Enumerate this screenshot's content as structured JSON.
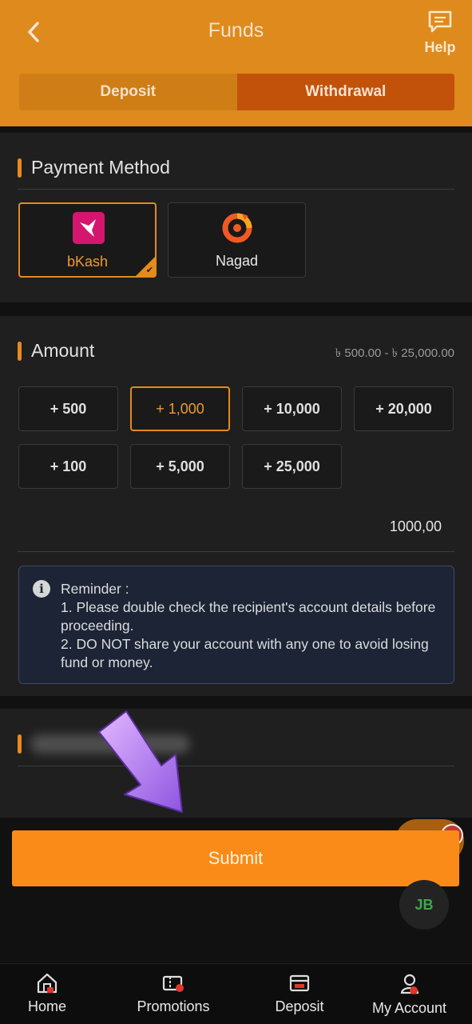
{
  "header": {
    "title": "Funds",
    "help_label": "Help",
    "tabs": [
      {
        "label": "Deposit",
        "active": false
      },
      {
        "label": "Withdrawal",
        "active": true
      }
    ]
  },
  "payment_method": {
    "title": "Payment Method",
    "options": [
      {
        "name": "bKash",
        "selected": true,
        "icon": "bkash-logo"
      },
      {
        "name": "Nagad",
        "selected": false,
        "icon": "nagad-logo"
      }
    ]
  },
  "amount": {
    "title": "Amount",
    "range": "৳ 500.00 - ৳ 25,000.00",
    "presets": [
      "+ 500",
      "+ 1,000",
      "+ 10,000",
      "+ 20,000",
      "+ 100",
      "+ 5,000",
      "+ 25,000"
    ],
    "selected_preset": "+ 1,000",
    "value": "1000,00"
  },
  "reminder": {
    "heading": "Reminder :",
    "line1": "1. Please double check the recipient's account details before proceeding.",
    "line2": "2. DO NOT share your account with any one to avoid losing fund or money."
  },
  "submit_label": "Submit",
  "floating_logo_text": "JB",
  "bottom_nav": [
    {
      "label": "Home",
      "icon": "home-icon"
    },
    {
      "label": "Promotions",
      "icon": "ticket-icon"
    },
    {
      "label": "Deposit",
      "icon": "card-icon"
    },
    {
      "label": "My Account",
      "icon": "account-icon"
    }
  ],
  "colors": {
    "header": "#de8a1c",
    "accent": "#e58a1c",
    "submit": "#fb8b18",
    "panel": "#1f1f1f",
    "reminder_bg": "#1c2436"
  }
}
